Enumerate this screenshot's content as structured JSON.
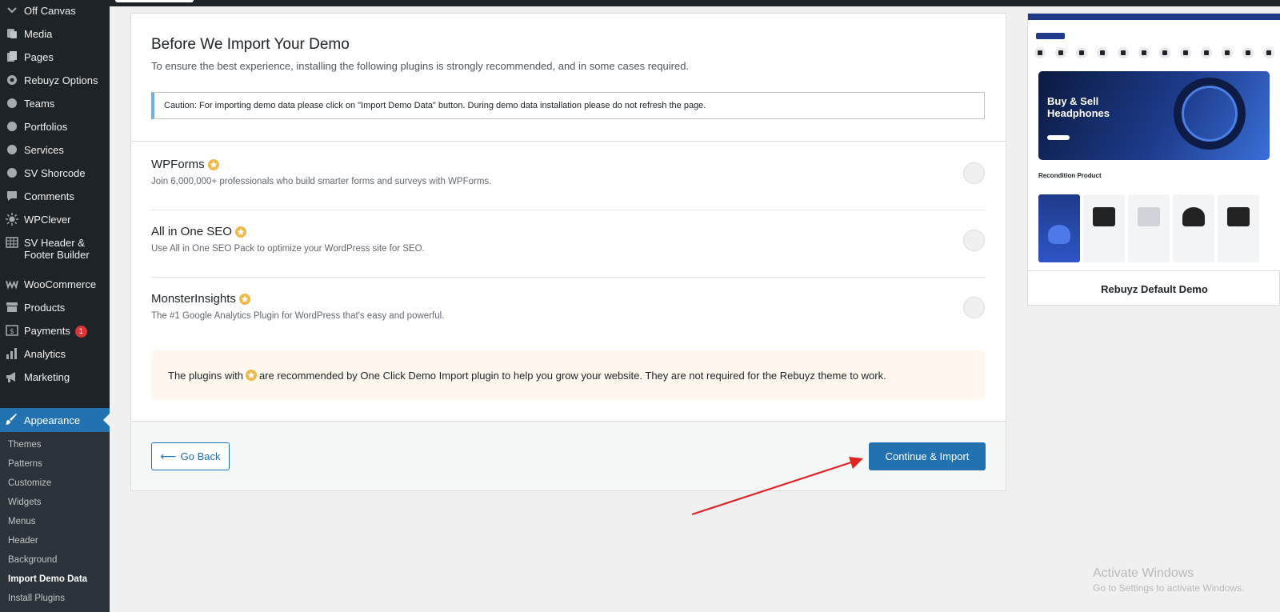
{
  "sidebar": {
    "items": [
      {
        "label": "Off Canvas",
        "icon": "chevron-down-icon"
      },
      {
        "label": "Media",
        "icon": "media-icon"
      },
      {
        "label": "Pages",
        "icon": "pages-icon"
      },
      {
        "label": "Rebuyz Options",
        "icon": "gear-icon"
      },
      {
        "label": "Teams",
        "icon": "circle-icon"
      },
      {
        "label": "Portfolios",
        "icon": "circle-icon"
      },
      {
        "label": "Services",
        "icon": "circle-icon"
      },
      {
        "label": "SV Shorcode",
        "icon": "circle-icon"
      },
      {
        "label": "Comments",
        "icon": "comment-icon"
      },
      {
        "label": "WPClever",
        "icon": "sun-icon"
      },
      {
        "label": "SV Header & Footer Builder",
        "icon": "grid-icon"
      },
      {
        "label": "WooCommerce",
        "icon": "woo-icon"
      },
      {
        "label": "Products",
        "icon": "archive-icon"
      },
      {
        "label": "Payments",
        "icon": "dollar-icon",
        "badge": "1"
      },
      {
        "label": "Analytics",
        "icon": "bar-chart-icon"
      },
      {
        "label": "Marketing",
        "icon": "megaphone-icon"
      }
    ],
    "appearance": {
      "label": "Appearance",
      "icon": "brush-icon"
    },
    "submenu": [
      "Themes",
      "Patterns",
      "Customize",
      "Widgets",
      "Menus",
      "Header",
      "Background",
      "Import Demo Data",
      "Install Plugins"
    ],
    "current_submenu": "Import Demo Data"
  },
  "main": {
    "title": "Before We Import Your Demo",
    "subtitle": "To ensure the best experience, installing the following plugins is strongly recommended, and in some cases required.",
    "caution": "Caution: For importing demo data please click on \"Import Demo Data\" button. During demo data installation please do not refresh the page.",
    "plugins": [
      {
        "name": "WPForms",
        "desc": "Join 6,000,000+ professionals who build smarter forms and surveys with WPForms."
      },
      {
        "name": "All in One SEO",
        "desc": "Use All in One SEO Pack to optimize your WordPress site for SEO."
      },
      {
        "name": "MonsterInsights",
        "desc": "The #1 Google Analytics Plugin for WordPress that's easy and powerful."
      }
    ],
    "note_before": "The plugins with",
    "note_after": "are recommended by One Click Demo Import plugin to help you grow your website. They are not required for the Rebuyz theme to work.",
    "go_back": "Go Back",
    "continue": "Continue & Import"
  },
  "preview": {
    "hero_title": "Buy & Sell Headphones",
    "section_title": "Recondition Product",
    "demo_name": "Rebuyz Default Demo"
  },
  "watermark": {
    "line1": "Activate Windows",
    "line2": "Go to Settings to activate Windows."
  },
  "colors": {
    "accent": "#2271b1",
    "sidebar": "#1d2327",
    "star": "#f0b849",
    "arrow": "#e02424"
  }
}
